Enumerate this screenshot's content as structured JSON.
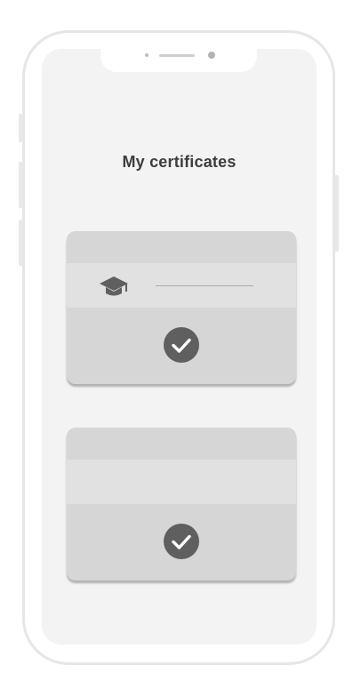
{
  "header": {
    "title": "My certificates"
  },
  "certificates": [
    {
      "icon": "graduation-cap-icon",
      "status_icon": "check-circle-icon"
    },
    {
      "icon": null,
      "status_icon": "check-circle-icon"
    }
  ],
  "colors": {
    "screen_background": "#f3f3f3",
    "card": "#d6d6d6",
    "card_band": "#e1e1e1",
    "icon": "#5f5f5f",
    "title_text": "#3d3d3d"
  }
}
